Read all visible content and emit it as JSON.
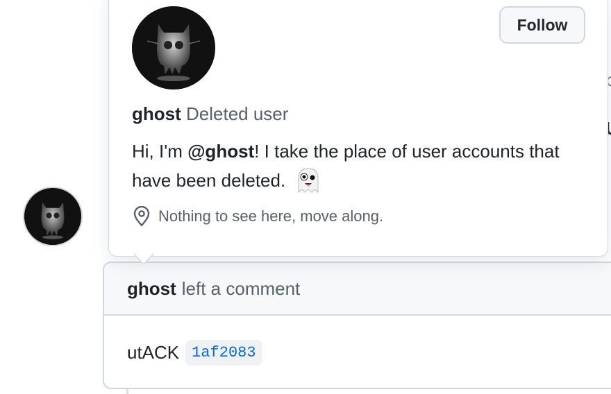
{
  "hovercard": {
    "follow_label": "Follow",
    "login": "ghost",
    "display_name": "Deleted user",
    "bio_prefix": "Hi, I'm ",
    "bio_mention": "@ghost",
    "bio_suffix": "! I take the place of user accounts that have been deleted.",
    "location_text": "Nothing to see here, move along.",
    "location_icon": "location-pin-icon",
    "emoji": "ghost-emoji"
  },
  "comment": {
    "author": "ghost",
    "action": "left a comment",
    "body_text": "utACK",
    "commit_ref": "1af2083"
  },
  "background": {
    "fragment_1": "b",
    "fragment_2": "U"
  },
  "colors": {
    "link": "#0969da",
    "muted": "#57606a",
    "border": "#d0d7de",
    "header_bg": "#f6f8fa"
  }
}
